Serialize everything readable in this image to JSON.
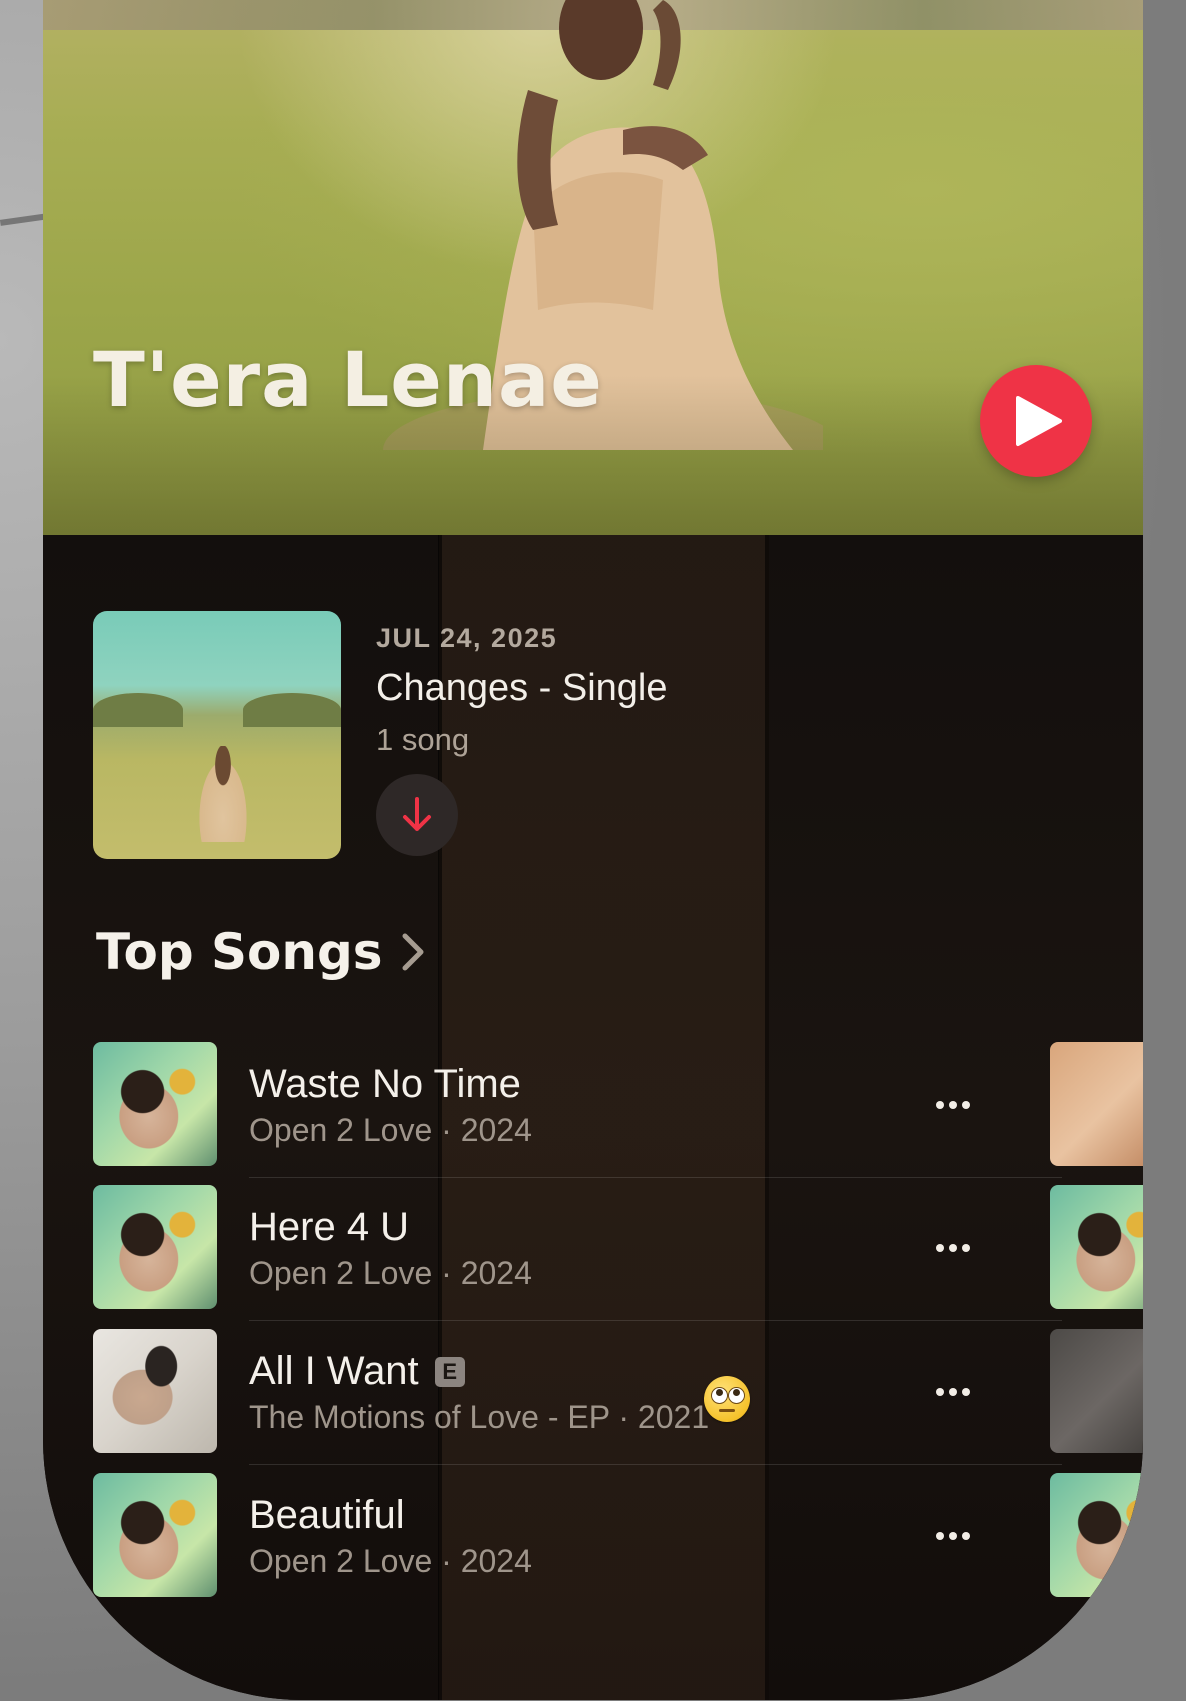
{
  "artist": {
    "name": "T'era Lenae"
  },
  "latest_release": {
    "date": "JUL 24, 2025",
    "title": "Changes - Single",
    "count": "1 song"
  },
  "top_songs": {
    "heading": "Top Songs",
    "songs": [
      {
        "title": "Waste No Time",
        "meta": "Open 2 Love · 2024",
        "explicit": false
      },
      {
        "title": "Here 4 U",
        "meta": "Open 2 Love · 2024",
        "explicit": false
      },
      {
        "title": "All I Want",
        "meta": "The Motions of Love - EP · 2021",
        "explicit": true,
        "badge": "E"
      },
      {
        "title": "Beautiful",
        "meta": "Open 2 Love · 2024",
        "explicit": false
      }
    ]
  },
  "icons": {
    "play": "play-icon",
    "download": "download-arrow-icon",
    "chevron": "chevron-right-icon",
    "more": "ellipsis-icon",
    "emoji": "rolling-eyes-emoji"
  },
  "colors": {
    "accent": "#ef3346",
    "background": "#130f0d",
    "primary_text": "#f4f0ea",
    "secondary_text": "#9f958b"
  }
}
